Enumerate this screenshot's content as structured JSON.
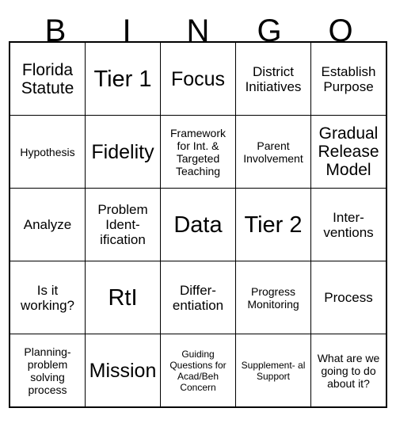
{
  "card": {
    "title": "BINGO",
    "header_letters": [
      "B",
      "I",
      "N",
      "G",
      "O"
    ],
    "grid": {
      "rows": 5,
      "columns": 5,
      "border_color": "#000000",
      "background_color": "#ffffff",
      "text_color": "#000000",
      "cells": [
        [
          {
            "text": "Florida Statute",
            "size": "lg"
          },
          {
            "text": "Tier 1",
            "size": "xxl"
          },
          {
            "text": "Focus",
            "size": "xl"
          },
          {
            "text": "District Initiatives",
            "size": "md"
          },
          {
            "text": "Establish Purpose",
            "size": "md"
          }
        ],
        [
          {
            "text": "Hypothesis",
            "size": "sm"
          },
          {
            "text": "Fidelity",
            "size": "xl"
          },
          {
            "text": "Framework for Int. & Targeted Teaching",
            "size": "sm"
          },
          {
            "text": "Parent Involvement",
            "size": "sm"
          },
          {
            "text": "Gradual Release Model",
            "size": "lg"
          }
        ],
        [
          {
            "text": "Analyze",
            "size": "md"
          },
          {
            "text": "Problem Ident- ification",
            "size": "md"
          },
          {
            "text": "Data",
            "size": "xxl"
          },
          {
            "text": "Tier 2",
            "size": "xxl"
          },
          {
            "text": "Inter- ventions",
            "size": "md"
          }
        ],
        [
          {
            "text": "Is it working?",
            "size": "md"
          },
          {
            "text": "RtI",
            "size": "xxl"
          },
          {
            "text": "Differ- entiation",
            "size": "md"
          },
          {
            "text": "Progress Monitoring",
            "size": "sm"
          },
          {
            "text": "Process",
            "size": "md"
          }
        ],
        [
          {
            "text": "Planning- problem solving process",
            "size": "sm"
          },
          {
            "text": "Mission",
            "size": "xl"
          },
          {
            "text": "Guiding Questions for Acad/Beh Concern",
            "size": "xs"
          },
          {
            "text": "Supplement- al Support",
            "size": "xs"
          },
          {
            "text": "What are we going to do about it?",
            "size": "sm"
          }
        ]
      ]
    }
  }
}
